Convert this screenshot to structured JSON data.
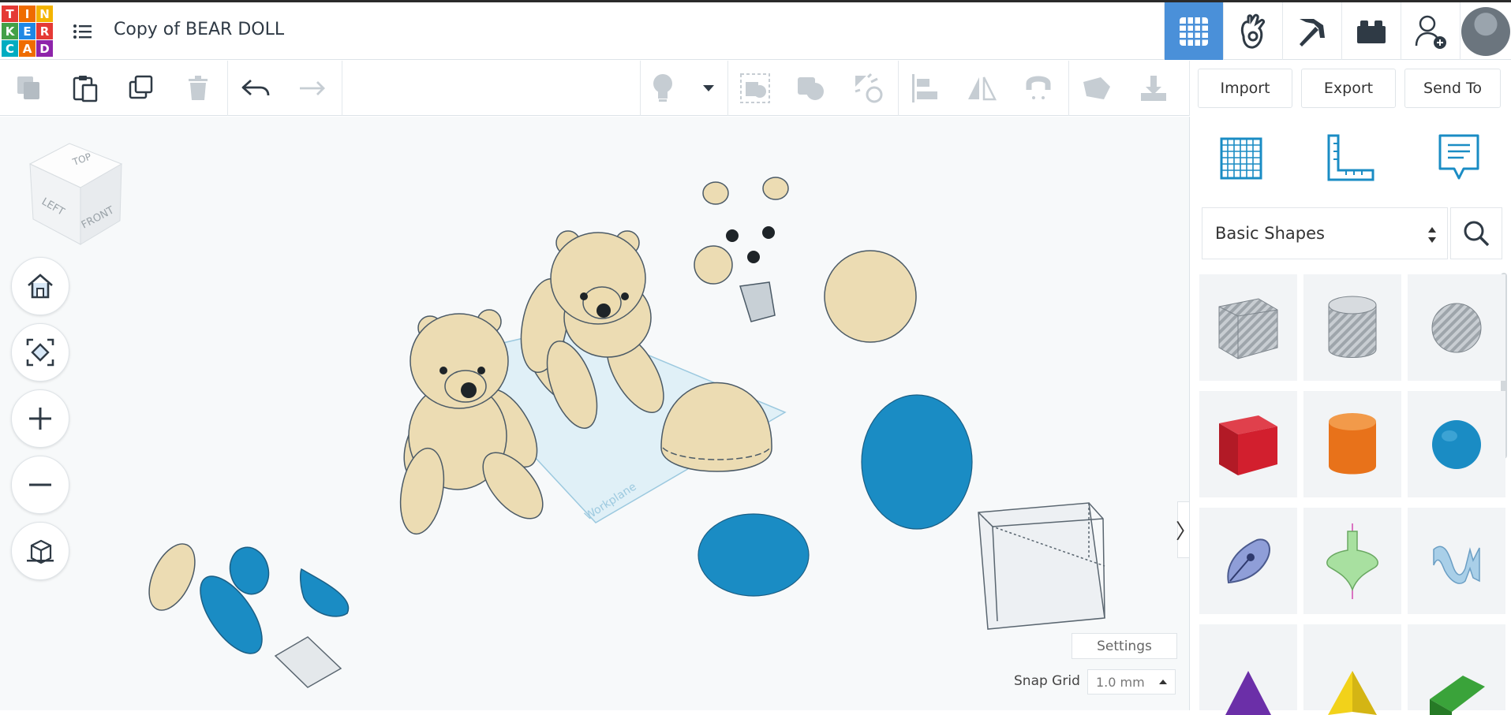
{
  "app": {
    "logo_letters": [
      "T",
      "I",
      "N",
      "K",
      "E",
      "R",
      "C",
      "A",
      "D"
    ],
    "logo_colors": [
      "#e53935",
      "#ef6c00",
      "#f4b400",
      "#43a047",
      "#1e88e5",
      "#e53935",
      "#00acc1",
      "#ef6c00",
      "#8e24aa"
    ],
    "document_title": "Copy of BEAR DOLL",
    "accent_color": "#4a90d9"
  },
  "topbar": {
    "buttons": [
      {
        "name": "3d-design-view",
        "icon": "grid-icon",
        "active": true
      },
      {
        "name": "circuits",
        "icon": "circuit-hand-icon"
      },
      {
        "name": "minecraft",
        "icon": "pickaxe-icon"
      },
      {
        "name": "lego-bricks",
        "icon": "brick-icon"
      },
      {
        "name": "invite-user",
        "icon": "add-user-icon"
      },
      {
        "name": "profile",
        "icon": "avatar-icon"
      }
    ]
  },
  "toolbar": {
    "tools": [
      "copy",
      "paste",
      "duplicate",
      "delete",
      "undo",
      "redo",
      "light",
      "light-dropdown",
      "group",
      "ungroup",
      "align-shapes",
      "align",
      "mirror",
      "magnet",
      "ruler",
      "download"
    ],
    "import_label": "Import",
    "export_label": "Export",
    "send_to_label": "Send To"
  },
  "viewcube": {
    "top": "TOP",
    "left": "LEFT",
    "front": "FRONT"
  },
  "canvas": {
    "workplane_label": "Workplane",
    "settings_label": "Settings",
    "snap_grid_label": "Snap Grid",
    "snap_grid_value": "1.0 mm"
  },
  "panel": {
    "top_icons": [
      "workplane-grid-icon",
      "ruler-icon",
      "notes-icon"
    ],
    "shape_category": "Basic Shapes",
    "shapes": [
      {
        "name": "box-hole",
        "color": "#b9bec4"
      },
      {
        "name": "cylinder-hole",
        "color": "#c8ccd0"
      },
      {
        "name": "sphere-hole",
        "color": "#b9bec4"
      },
      {
        "name": "box",
        "color": "#d21f2e"
      },
      {
        "name": "cylinder",
        "color": "#e8721a"
      },
      {
        "name": "sphere",
        "color": "#1a8cc4"
      },
      {
        "name": "scribble",
        "color": "#8f9ed8"
      },
      {
        "name": "shape-generator",
        "color": "#a8e0a0"
      },
      {
        "name": "text-shape",
        "color": "#a9cfe8"
      },
      {
        "name": "cone",
        "color": "#6b2fa8"
      },
      {
        "name": "pyramid",
        "color": "#f2d21a"
      },
      {
        "name": "roof",
        "color": "#3aa33a"
      }
    ]
  }
}
